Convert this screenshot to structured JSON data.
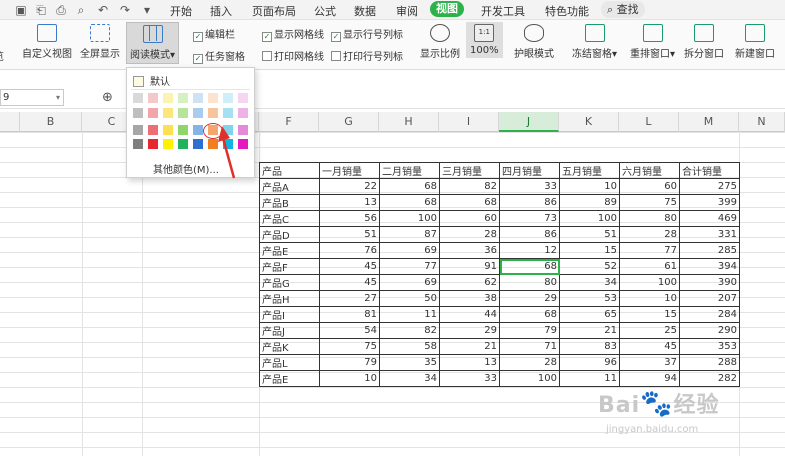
{
  "menubar": {
    "items": [
      "开始",
      "插入",
      "页面布局",
      "公式",
      "数据",
      "审阅",
      "视图",
      "开发工具",
      "特色功能"
    ],
    "active_index": 6,
    "search_label": "查找"
  },
  "ribbon": {
    "buttons": [
      "览",
      "自定义视图",
      "全屏显示",
      "阅读模式",
      "显示比例",
      "100%",
      "护眼模式",
      "冻结窗格",
      "重排窗口",
      "拆分窗口",
      "新建窗口"
    ],
    "checkboxes": [
      {
        "label": "编辑栏",
        "checked": true
      },
      {
        "label": "显示网格线",
        "checked": true
      },
      {
        "label": "显示行号列标",
        "checked": true
      },
      {
        "label": "任务窗格",
        "checked": true
      },
      {
        "label": "打印网格线",
        "checked": false
      },
      {
        "label": "打印行号列标",
        "checked": false
      }
    ]
  },
  "formula_bar": {
    "name_box": "9"
  },
  "columns": [
    "B",
    "C",
    "F",
    "G",
    "H",
    "I",
    "J",
    "K",
    "L",
    "M",
    "N"
  ],
  "active_column": "J",
  "table": {
    "headers": [
      "产品",
      "一月销量",
      "二月销量",
      "三月销量",
      "四月销量",
      "五月销量",
      "六月销量",
      "合计销量"
    ],
    "rows": [
      [
        "产品A",
        "22",
        "68",
        "82",
        "33",
        "10",
        "60",
        "275"
      ],
      [
        "产品B",
        "13",
        "68",
        "68",
        "86",
        "89",
        "75",
        "399"
      ],
      [
        "产品C",
        "56",
        "100",
        "60",
        "73",
        "100",
        "80",
        "469"
      ],
      [
        "产品D",
        "51",
        "87",
        "28",
        "86",
        "51",
        "28",
        "331"
      ],
      [
        "产品E",
        "76",
        "69",
        "36",
        "12",
        "15",
        "77",
        "285"
      ],
      [
        "产品F",
        "45",
        "77",
        "91",
        "68",
        "52",
        "61",
        "394"
      ],
      [
        "产品G",
        "45",
        "69",
        "62",
        "80",
        "34",
        "100",
        "390"
      ],
      [
        "产品H",
        "27",
        "50",
        "38",
        "29",
        "53",
        "10",
        "207"
      ],
      [
        "产品I",
        "81",
        "11",
        "44",
        "68",
        "65",
        "15",
        "284"
      ],
      [
        "产品J",
        "54",
        "82",
        "29",
        "79",
        "21",
        "25",
        "290"
      ],
      [
        "产品K",
        "75",
        "58",
        "21",
        "71",
        "83",
        "45",
        "353"
      ],
      [
        "产品L",
        "79",
        "35",
        "13",
        "28",
        "96",
        "37",
        "288"
      ],
      [
        "产品E",
        "10",
        "34",
        "33",
        "100",
        "11",
        "94",
        "282"
      ]
    ],
    "selected_cell": {
      "row": 5,
      "col": 4
    }
  },
  "color_dropdown": {
    "default_label": "默认",
    "more_label": "其他颜色(M)...",
    "palette_rows": [
      [
        "#d9d9d9",
        "#f4c7c8",
        "#fdf3b1",
        "#d5f0c3",
        "#cfe2f5",
        "#fbe3cf",
        "#d0eef7",
        "#f6d5f0"
      ],
      [
        "#bfbfbf",
        "#f3a6aa",
        "#fde77c",
        "#b7e39a",
        "#a9cbee",
        "#f8c49d",
        "#a7e0f1",
        "#eeb2e4"
      ],
      [
        "#a6a6a6",
        "#ee6e75",
        "#fbe14f",
        "#8fd66a",
        "#84b3e8",
        "#f6a56c",
        "#7fd3ec",
        "#e58ad6"
      ],
      [
        "#7f7f7f",
        "#e8262f",
        "#fff200",
        "#1fb35d",
        "#2f6fd2",
        "#f17f20",
        "#0eb4e2",
        "#e31ac0"
      ]
    ]
  },
  "watermark": {
    "text": "Bai 经验",
    "sub": "jingyan.baidu.com"
  }
}
